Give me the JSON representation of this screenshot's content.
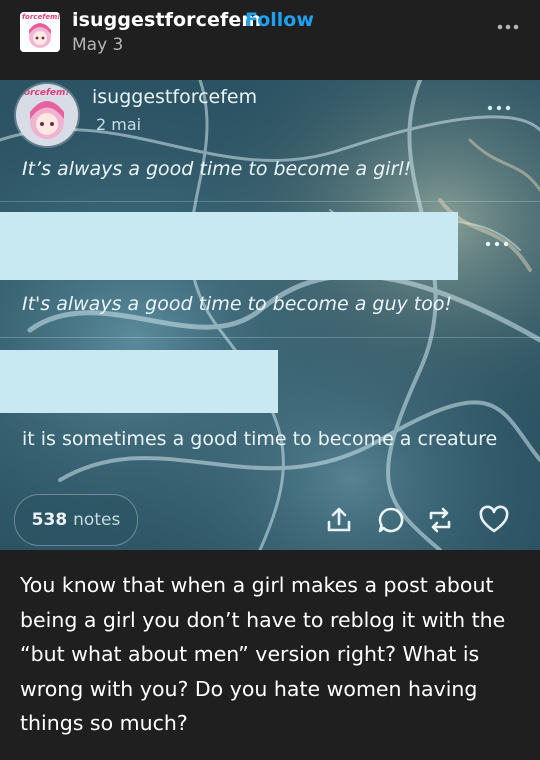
{
  "post": {
    "author": "isuggestforcefem",
    "follow_label": "Follow",
    "date": "May 3",
    "avatar_text": "forcefem!",
    "more_icon": "more-horizontal-icon"
  },
  "embedded": {
    "author": "isuggestforcefem",
    "date": "2 mai",
    "avatar_text": "forcefem!",
    "lines": [
      "It’s always a good time to become a girl!",
      "It's always a good time to become a guy too!",
      "it is sometimes a good time to become a creature"
    ],
    "notes_count": "538",
    "notes_label": "notes",
    "actions": [
      "share-icon",
      "reply-icon",
      "reblog-icon",
      "like-icon"
    ],
    "colors": {
      "background": "#2a4f5e",
      "redaction": "#c8e8f2"
    }
  },
  "caption": "You know that when a girl makes a post about being a girl you don’t have to reblog it with the “but what about men” version right? What is wrong with you? Do you hate women having things so much?",
  "colors": {
    "page_bg": "#1f1f1f",
    "follow": "#1da1f2"
  }
}
